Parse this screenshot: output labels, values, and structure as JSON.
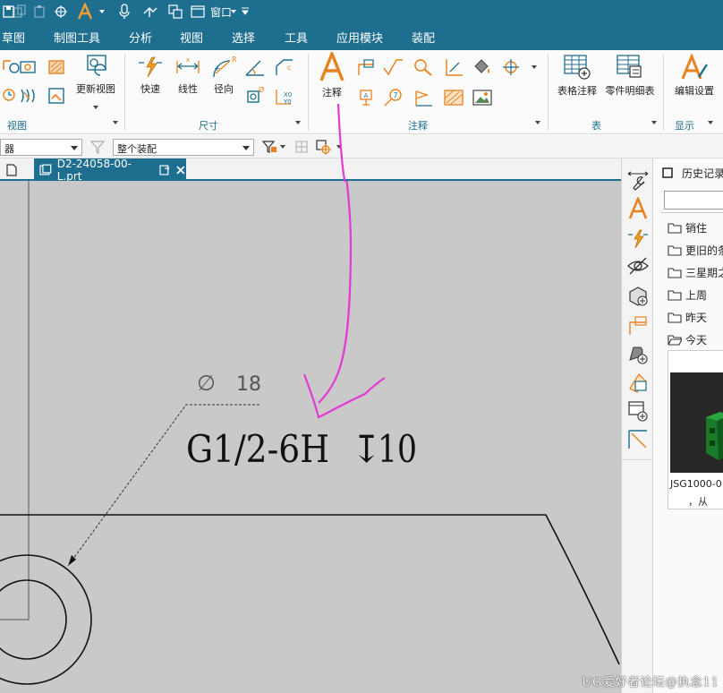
{
  "quick_access": {
    "window_label": "窗口"
  },
  "menu": [
    "草图",
    "制图工具",
    "分析",
    "视图",
    "选择",
    "工具",
    "应用模块",
    "装配"
  ],
  "ribbon": {
    "groups": {
      "view": "视图",
      "dimension": "尺寸",
      "annotation": "注释",
      "table": "表",
      "display": "显示"
    },
    "buttons": {
      "update_view": "更新视图",
      "rapid": "快速",
      "linear": "线性",
      "radial": "径向",
      "note": "注释",
      "tabular_note": "表格注释",
      "parts_list": "零件明细表",
      "edit_settings": "编辑设置"
    }
  },
  "selection_bar": {
    "filter_value": "器",
    "scope_value": "整个装配"
  },
  "document_tab": {
    "title": "D2-24058-00-L.prt"
  },
  "drawing": {
    "diameter_symbol": "∅",
    "diameter_value": "18",
    "thread_callout": "G1/2-6H",
    "depth_symbol": "↧",
    "depth_value": "10",
    "ink_annotation_color": "#e43ad4"
  },
  "history_panel": {
    "title": "历史记录",
    "folders": [
      "销住",
      "更旧的条",
      "三星期之",
      "上周",
      "昨天",
      "今天"
    ],
    "thumbnail_name": "JSG1000-0",
    "thumbnail_sub": "，从"
  },
  "watermark": "UG爱好者论坛@执念11",
  "colors": {
    "accent": "#1d6e8f",
    "icon_orange": "#e8821e",
    "canvas": "#c9c9c9"
  }
}
